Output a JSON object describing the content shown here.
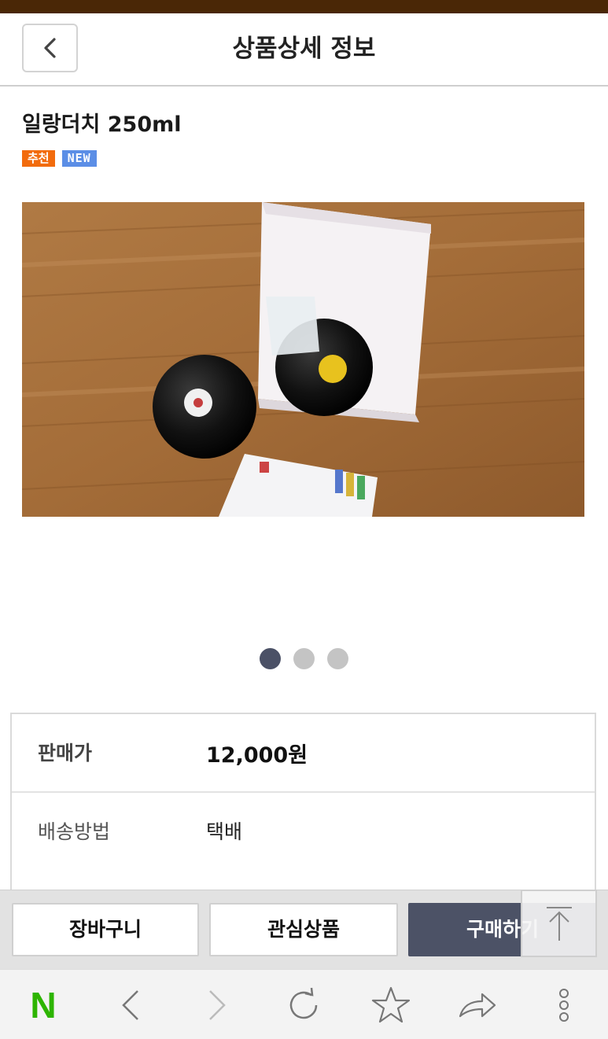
{
  "header": {
    "title": "상품상세 정보",
    "back_icon": "chevron-left-icon"
  },
  "product": {
    "name": "일랑더치 250ml",
    "badges": [
      {
        "label": "추천",
        "color": "#f26b0d"
      },
      {
        "label": "NEW",
        "color": "#5b8ee6"
      }
    ]
  },
  "carousel": {
    "total": 3,
    "active_index": 0
  },
  "info": {
    "price_label": "판매가",
    "price_value": "12,000원",
    "shipping_label": "배송방법",
    "shipping_value": "택배"
  },
  "actions": {
    "cart_label": "장바구니",
    "wishlist_label": "관심상품",
    "buy_label": "구매하기",
    "scroll_top_icon": "arrow-up-icon"
  },
  "browser": {
    "items": [
      "naver-logo",
      "back-icon",
      "forward-icon",
      "refresh-icon",
      "star-icon",
      "share-icon",
      "more-icon"
    ],
    "logo_text": "N",
    "logo_color": "#2db400"
  },
  "colors": {
    "top_bar": "#4a2706",
    "accent_dark": "#4c5266"
  }
}
